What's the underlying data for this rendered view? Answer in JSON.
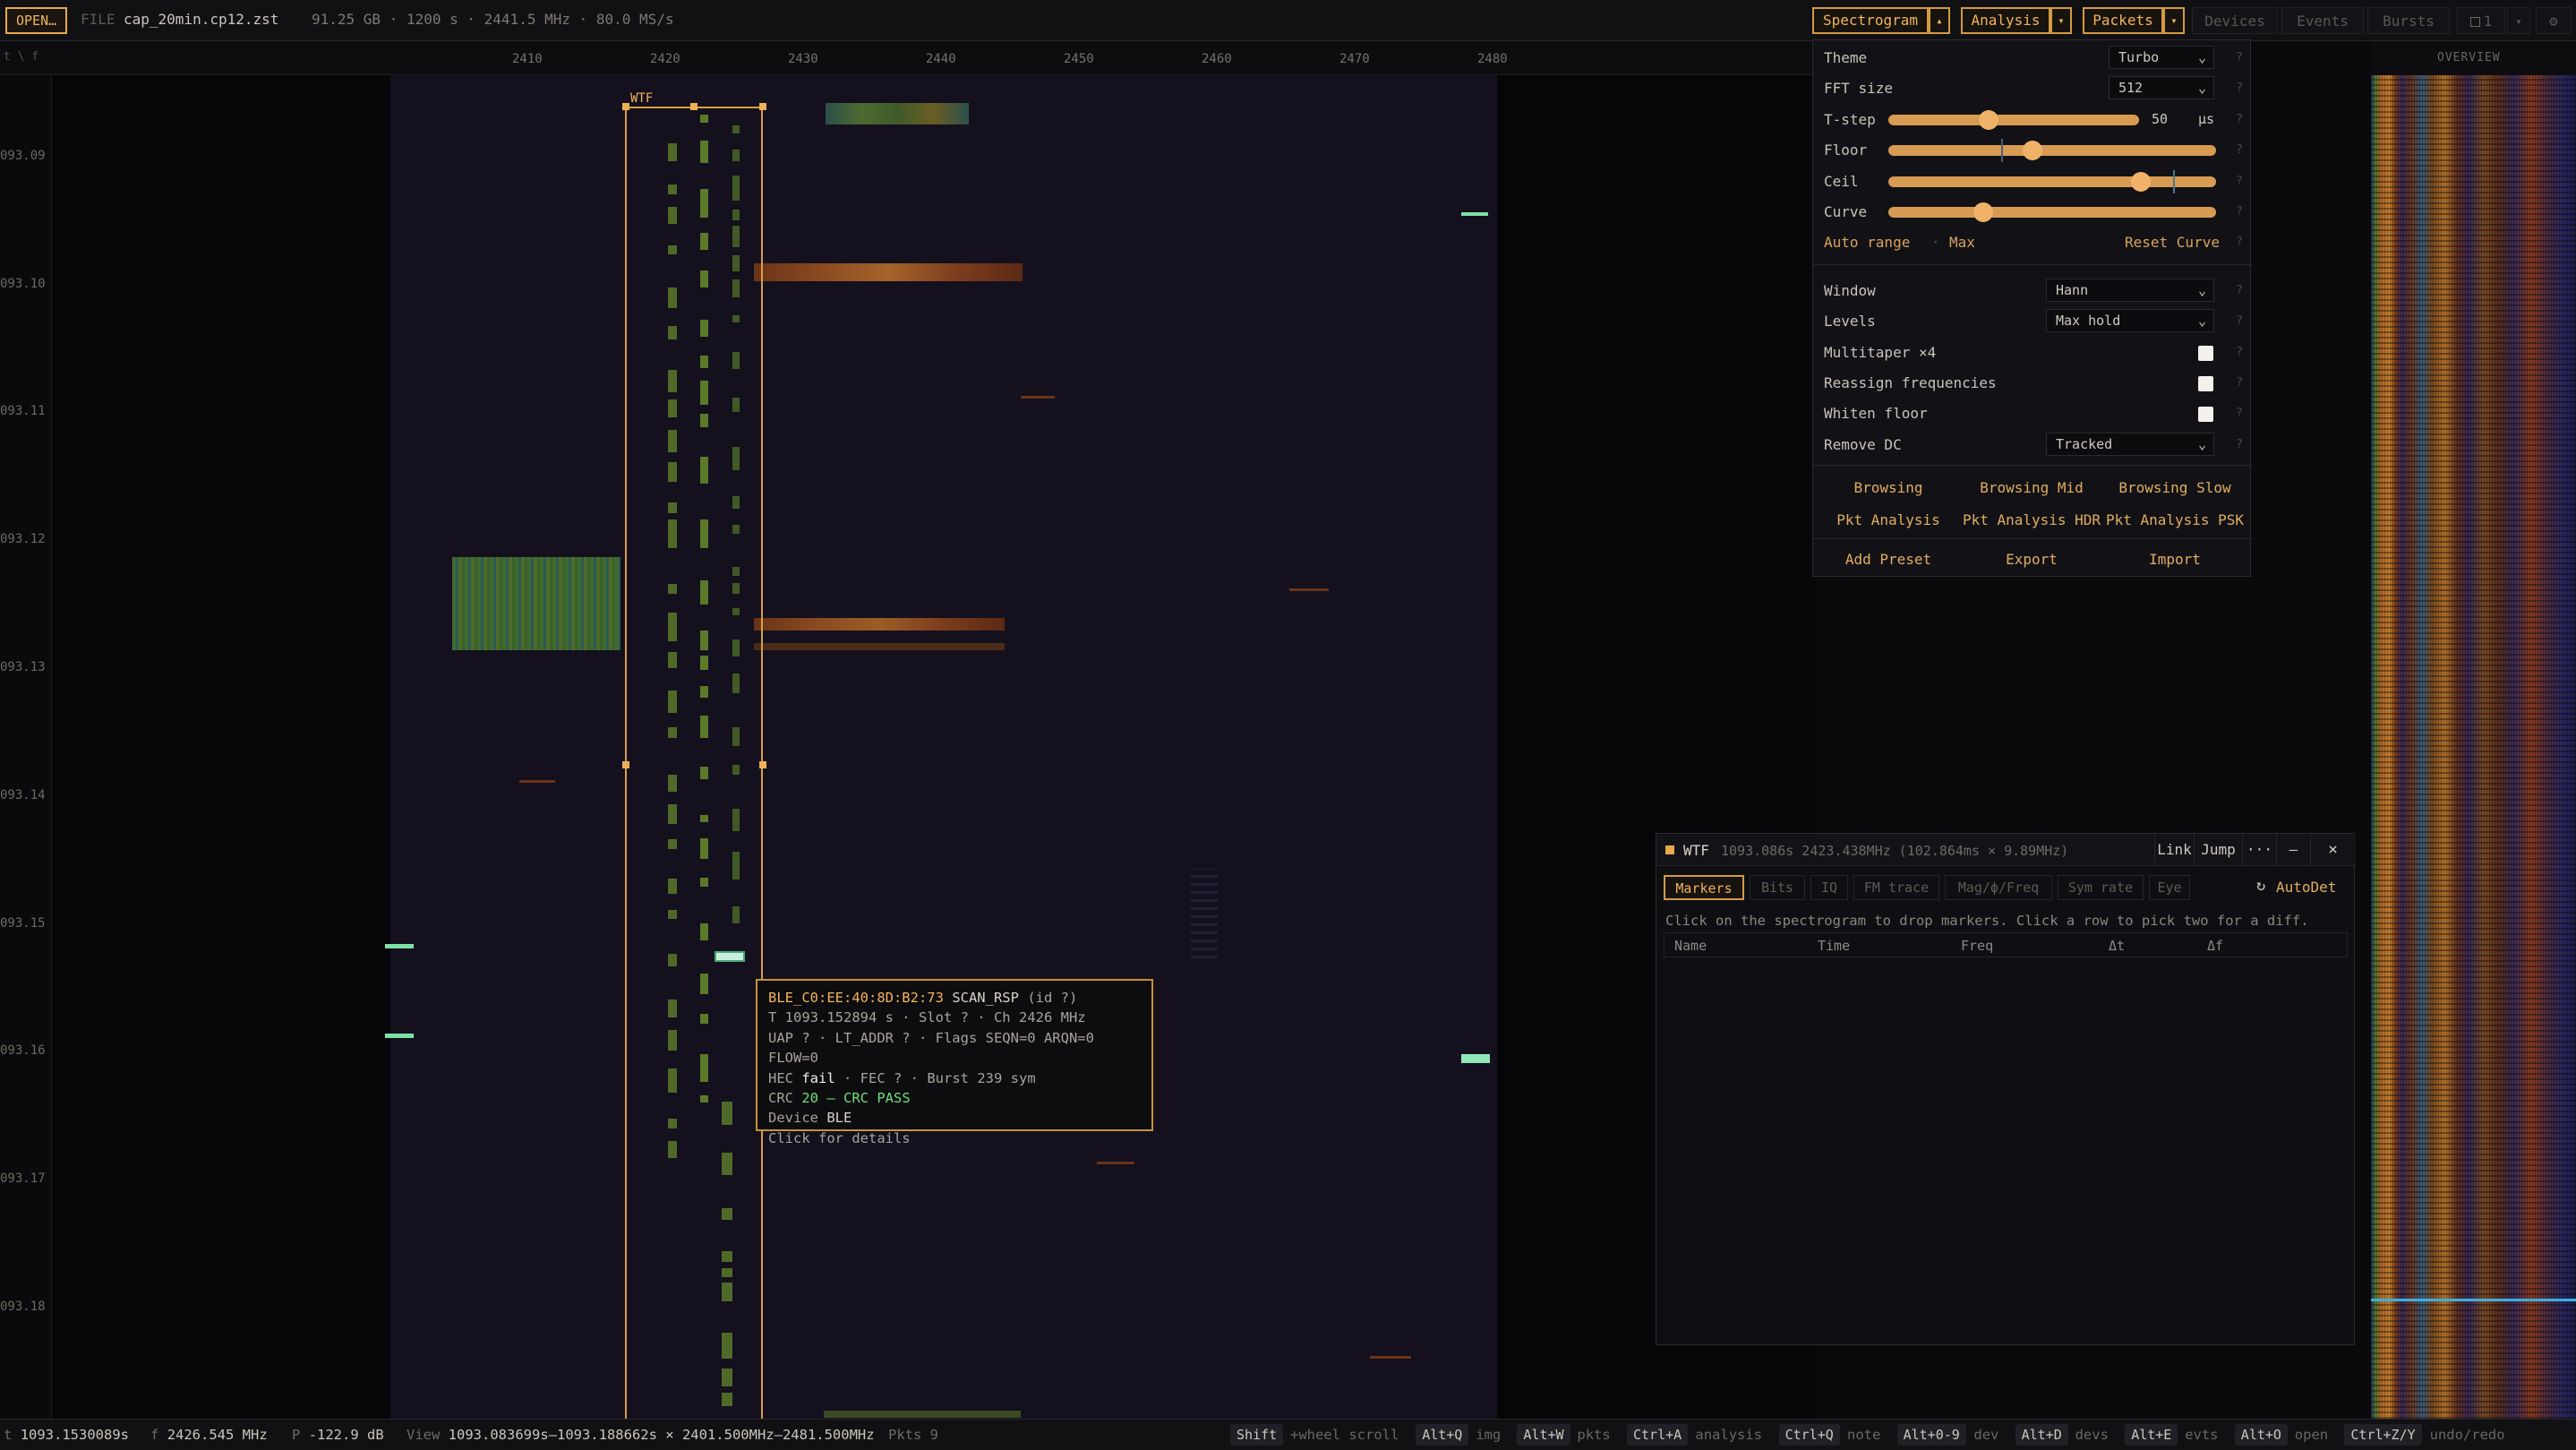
{
  "topbar": {
    "open_label": "OPEN…",
    "file_prefix": "FILE",
    "file_name": "cap_20min.cp12.zst",
    "file_info": "91.25 GB · 1200 s · 2441.5 MHz · 80.0 MS/s",
    "spectrogram_label": "Spectrogram",
    "spectrogram_caret": "▴",
    "analysis_label": "Analysis",
    "analysis_caret": "▾",
    "packets_label": "Packets",
    "packets_caret": "▾",
    "devices_label": "Devices",
    "events_label": "Events",
    "bursts_label": "Bursts",
    "panel_count": "1",
    "panel_count_caret": "▾",
    "gear": "⚙"
  },
  "axis": {
    "corner": "t \\ f",
    "x_ticks": [
      "2410",
      "2420",
      "2430",
      "2440",
      "2450",
      "2460",
      "2470",
      "2480"
    ],
    "y_ticks": [
      "093.09",
      "093.10",
      "093.11",
      "093.12",
      "093.13",
      "093.14",
      "093.15",
      "093.16",
      "093.17",
      "093.18"
    ],
    "overview_label": "OVERVIEW"
  },
  "selection": {
    "label": "WTF"
  },
  "settings": {
    "theme_label": "Theme",
    "theme_value": "Turbo",
    "fft_label": "FFT size",
    "fft_value": "512",
    "tstep_label": "T-step",
    "tstep_value": "50",
    "tstep_unit": "µs",
    "tstep_level": 0.4,
    "floor_label": "Floor",
    "floor_level": 0.44,
    "ceil_label": "Ceil",
    "ceil_level": 0.77,
    "curve_label": "Curve",
    "curve_level": 0.29,
    "auto_range": "Auto range",
    "auto_sep": "·",
    "max": "Max",
    "reset_curve": "Reset Curve",
    "window_label": "Window",
    "window_value": "Hann",
    "levels_label": "Levels",
    "levels_value": "Max hold",
    "multitaper_label": "Multitaper ×4",
    "reassign_label": "Reassign frequencies",
    "whiten_label": "Whiten floor",
    "remove_dc_label": "Remove DC",
    "remove_dc_value": "Tracked",
    "help": "?",
    "presets": [
      "Browsing",
      "Browsing Mid",
      "Browsing Slow",
      "Pkt Analysis",
      "Pkt Analysis HDR",
      "Pkt Analysis PSK"
    ],
    "add_preset": "Add Preset",
    "export": "Export",
    "import": "Import"
  },
  "markers": {
    "title": "WTF",
    "info": "1093.086s 2423.438MHz (102.864ms × 9.89MHz)",
    "link": "Link",
    "jump": "Jump",
    "more": "···",
    "minimize": "–",
    "close": "×",
    "tabs": [
      "Markers",
      "Bits",
      "IQ",
      "FM trace",
      "Mag/ϕ/Freq",
      "Sym rate",
      "Eye"
    ],
    "autodet": "AutoDet",
    "hint": "Click on the spectrogram to drop markers. Click a row to pick two for a diff.",
    "columns": [
      "Name",
      "Time",
      "Freq",
      "Δt",
      "Δf"
    ]
  },
  "tooltip": {
    "device": "BLE_C0:EE:40:8D:B2:73",
    "pdu": "SCAN_RSP",
    "id": "(id ?)",
    "line2": "T 1093.152894 s · Slot ? · Ch 2426 MHz",
    "line3": "UAP ? · LT_ADDR ? · Flags SEQN=0 ARQN=0 FLOW=0",
    "hec_label": "HEC",
    "hec_value": "fail",
    "hec_rest": "· FEC ? · Burst 239 sym",
    "crc_label": "CRC",
    "crc_value": "20 — CRC PASS",
    "device_label": "Device",
    "device_value": "BLE",
    "footer": "Click for details"
  },
  "status": {
    "t_label": "t",
    "t_value": "1093.1530089s",
    "f_label": "f",
    "f_value": "2426.545 MHz",
    "p_label": "P",
    "p_value": "-122.9 dB",
    "view_label": "View",
    "view_value": "1093.083699s–1093.188662s × 2401.500MHz–2481.500MHz",
    "pkts": "Pkts 9",
    "shortcuts": [
      {
        "key": "Shift",
        "desc": "+wheel scroll"
      },
      {
        "key": "Alt+Q",
        "desc": "img"
      },
      {
        "key": "Alt+W",
        "desc": "pkts"
      },
      {
        "key": "Ctrl+A",
        "desc": "analysis"
      },
      {
        "key": "Ctrl+Q",
        "desc": "note"
      },
      {
        "key": "Alt+0-9",
        "desc": "dev"
      },
      {
        "key": "Alt+D",
        "desc": "devs"
      },
      {
        "key": "Alt+E",
        "desc": "evts"
      },
      {
        "key": "Alt+O",
        "desc": "open"
      },
      {
        "key": "Ctrl+Z/Y",
        "desc": "undo/redo"
      }
    ]
  },
  "colors": {
    "accent": "#e9a94b",
    "pass": "#6ee07a",
    "fail": "#f3efe8",
    "spectrogram_bg": "#14101e"
  }
}
